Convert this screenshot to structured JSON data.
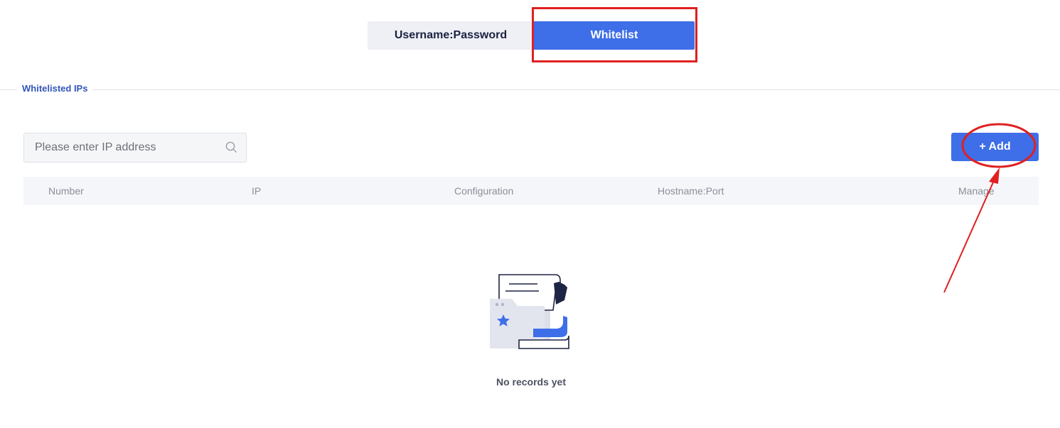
{
  "tabs": [
    {
      "label": "Username:Password",
      "active": false
    },
    {
      "label": "Whitelist",
      "active": true
    }
  ],
  "section": {
    "title": "Whitelisted IPs"
  },
  "search": {
    "placeholder": "Please enter IP address",
    "value": "",
    "icon": "search-icon"
  },
  "toolbar": {
    "add_label": "+ Add"
  },
  "table": {
    "columns": [
      "Number",
      "IP",
      "Configuration",
      "Hostname:Port",
      "Manage"
    ],
    "rows": []
  },
  "empty": {
    "text": "No records yet",
    "icon": "empty-folder-illustration"
  },
  "colors": {
    "accent": "#3e6ee8",
    "annotation": "#e02020",
    "section_title": "#3356b8"
  }
}
